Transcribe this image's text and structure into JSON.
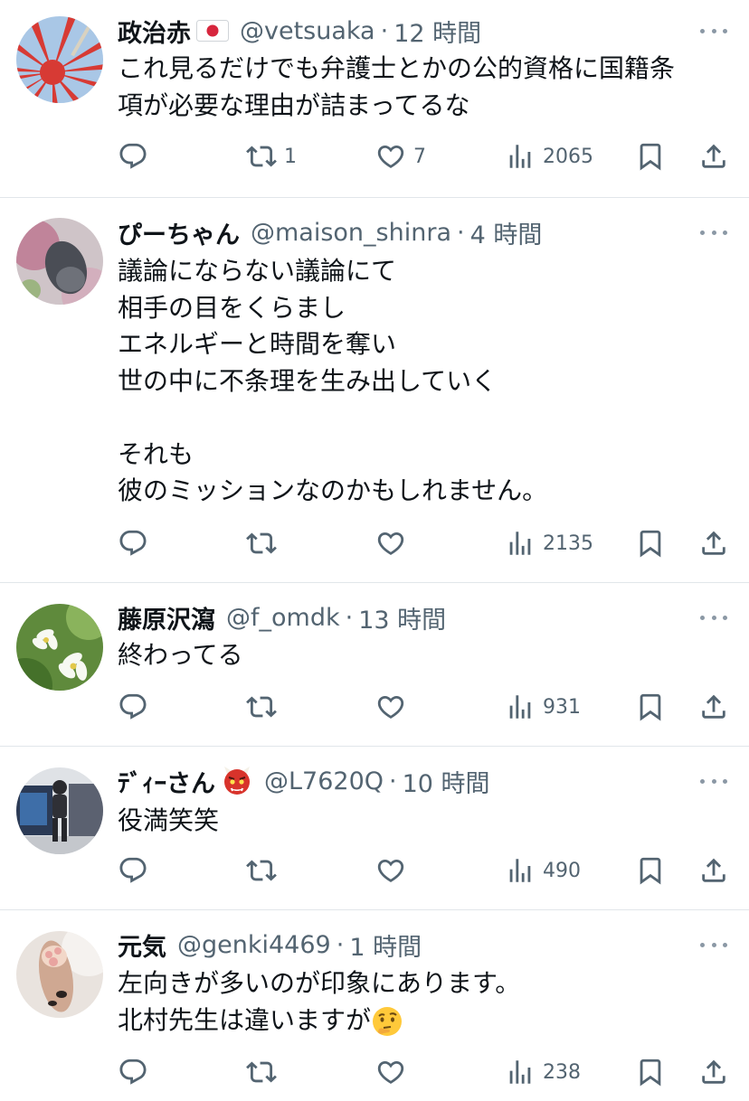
{
  "tweets": [
    {
      "name": "政治赤",
      "badge_icon": "japan-flag-icon",
      "handle": "@vetsuaka",
      "dot": "·",
      "time": "12 時間",
      "lines": [
        "これ見るだけでも弁護士とかの公的資格に国籍条",
        "項が必要な理由が詰まってるな"
      ],
      "retweets": "1",
      "likes": "7",
      "views": "2065"
    },
    {
      "name": "ぴーちゃん",
      "handle": "@maison_shinra",
      "dot": "·",
      "time": "4 時間",
      "lines": [
        "議論にならない議論にて",
        "相手の目をくらまし",
        "エネルギーと時間を奪い",
        "世の中に不条理を生み出していく",
        "",
        "それも",
        "彼のミッションなのかもしれません。"
      ],
      "retweets": "",
      "likes": "",
      "views": "2135"
    },
    {
      "name": "藤原沢瀉",
      "handle": "@f_omdk",
      "dot": "·",
      "time": "13 時間",
      "lines": [
        "終わってる"
      ],
      "retweets": "",
      "likes": "",
      "views": "931"
    },
    {
      "name": "ﾃﾞｨｰさん",
      "badge_icon": "red-oni-emoji",
      "handle": "@L7620Q",
      "dot": "·",
      "time": "10 時間",
      "lines": [
        "役満笑笑"
      ],
      "retweets": "",
      "likes": "",
      "views": "490"
    },
    {
      "name": "元気",
      "handle": "@genki4469",
      "dot": "·",
      "time": "1 時間",
      "lines": [
        "左向きが多いのが印象にあります。",
        "北村先生は違いますが"
      ],
      "trailing_emoji": "thinking-face-emoji",
      "retweets": "",
      "likes": "",
      "views": "238"
    }
  ],
  "icons": {
    "reply": "reply-icon",
    "retweet": "retweet-icon",
    "like": "heart-icon",
    "views": "views-icon",
    "bookmark": "bookmark-icon",
    "share": "share-icon",
    "more": "more-icon"
  },
  "colors": {
    "text": "#0f1419",
    "secondary": "#536471",
    "divider": "#e1e6ea"
  }
}
